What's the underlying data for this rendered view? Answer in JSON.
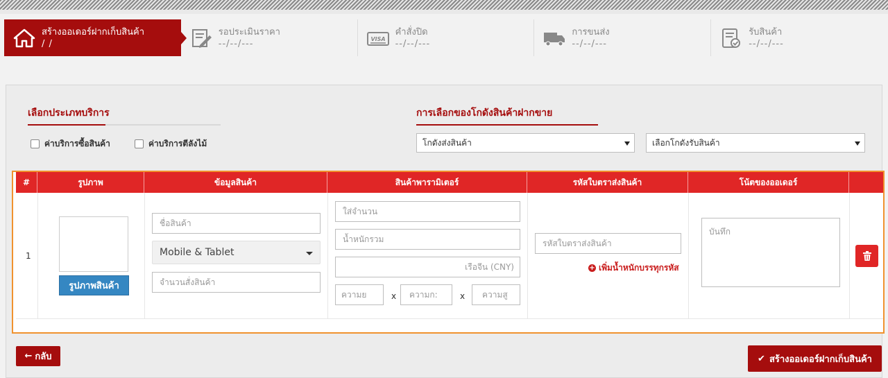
{
  "steps": [
    {
      "title": "สร้างออเดอร์ฝากเก็บสินค้า",
      "date": " /  /",
      "icon": "house-icon",
      "active": true
    },
    {
      "title": "รอประเมินราคา",
      "date": "--/--/---",
      "icon": "edit-form-icon",
      "active": false
    },
    {
      "title": "คำสั่งปิด",
      "date": "--/--/---",
      "icon": "visa-card-icon",
      "active": false
    },
    {
      "title": "การขนส่ง",
      "date": "--/--/---",
      "icon": "truck-icon",
      "active": false
    },
    {
      "title": "รับสินค้า",
      "date": "--/--/---",
      "icon": "checklist-icon",
      "active": false
    }
  ],
  "service": {
    "title": "เลือกประเภทบริการ",
    "options": [
      "ค่าบริการซื้อสินค้า",
      "ค่าบริการตีลังไม้"
    ]
  },
  "warehouse": {
    "title": "การเลือกของโกดังสินค้าฝากขาย",
    "send_select": "โกดังส่งสินค้า",
    "receive_select": "เลือกโกดังรับสินค้า"
  },
  "table": {
    "headers": [
      "#",
      "รูปภาพ",
      "ข้อมูลสินค้า",
      "สินค้าพารามิเตอร์",
      "รหัสใบตราส่งสินค้า",
      "โน้ตของออเดอร์",
      ""
    ],
    "row": {
      "index": "1",
      "image_button": "รูปภาพสินค้า",
      "product_name_placeholder": "ชื่อสินค้า",
      "category_selected": "Mobile & Tablet",
      "quantity_placeholder": "จำนวนสั่งสินค้า",
      "amount_placeholder": "ใส่จำนวน",
      "weight_placeholder": "น้ำหนักรวม",
      "price_placeholder": "เรือจีน (CNY)",
      "width_placeholder": "ความย",
      "length_placeholder": "ความก:",
      "height_placeholder": "ความสู",
      "dim_x": "x",
      "tracking_placeholder": "รหัสใบตราส่งสินค้า",
      "add_weight_link": "เพิ่มน้ำหนักบรรทุกรหัส",
      "note_placeholder": "บันทึก"
    }
  },
  "footer": {
    "back_label": "กลับ",
    "create_label": "สร้างออเดอร์ฝากเก็บสินค้า"
  },
  "colors": {
    "brand": "#a50d0d",
    "header_red": "#e02626",
    "highlight": "#f0922e",
    "button_blue": "#3587c2"
  }
}
